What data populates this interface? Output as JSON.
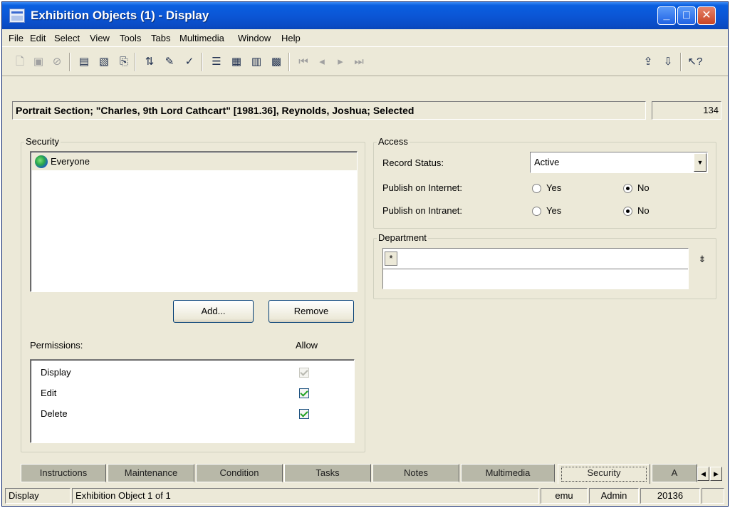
{
  "window": {
    "title": "Exhibition Objects (1) - Display",
    "minimize": "_",
    "maximize": "□",
    "close": "✕"
  },
  "menu": [
    "File",
    "Edit",
    "Select",
    "View",
    "Tools",
    "Tabs",
    "Multimedia",
    "Window",
    "Help"
  ],
  "record": {
    "summary": "Portrait Section; \"Charles, 9th Lord Cathcart\" [1981.36], Reynolds, Joshua; Selected",
    "count": "134"
  },
  "security": {
    "title": "Security",
    "groups": [
      "Everyone"
    ],
    "add_label": "Add...",
    "remove_label": "Remove",
    "permissions_label": "Permissions:",
    "allow_label": "Allow",
    "permissions": [
      {
        "name": "Display",
        "allow": true,
        "disabled": true
      },
      {
        "name": "Edit",
        "allow": true,
        "disabled": false
      },
      {
        "name": "Delete",
        "allow": true,
        "disabled": false
      }
    ]
  },
  "access": {
    "title": "Access",
    "record_status_label": "Record Status:",
    "record_status_value": "Active",
    "publish_internet_label": "Publish on Internet:",
    "publish_intranet_label": "Publish on Intranet:",
    "yes_label": "Yes",
    "no_label": "No",
    "publish_internet": "No",
    "publish_intranet": "No"
  },
  "department": {
    "title": "Department",
    "star": "*",
    "lookup": "⇟"
  },
  "tabs": [
    "Instructions",
    "Maintenance",
    "Condition",
    "Tasks",
    "Notes",
    "Multimedia",
    "Security",
    "A"
  ],
  "active_tab": "Security",
  "status": {
    "mode": "Display",
    "position": "Exhibition Object 1 of 1",
    "user": "emu",
    "role": "Admin",
    "id": "20136"
  },
  "colors": {
    "title_bar": "#0a5fe0",
    "face": "#ece9d8",
    "check_green": "#21a121",
    "tab_inactive": "#b8b8a8"
  },
  "icons": [
    "new-icon",
    "save-icon",
    "cancel-icon",
    "display-icon",
    "edit-icon",
    "insert-icon",
    "sort-icon",
    "notes-icon",
    "spell-check-icon",
    "list-view-icon",
    "table-view-icon",
    "detail-view-icon",
    "page-view-icon",
    "first-icon",
    "previous-icon",
    "next-icon",
    "last-icon",
    "attach-icon",
    "detach-icon",
    "help-icon"
  ]
}
